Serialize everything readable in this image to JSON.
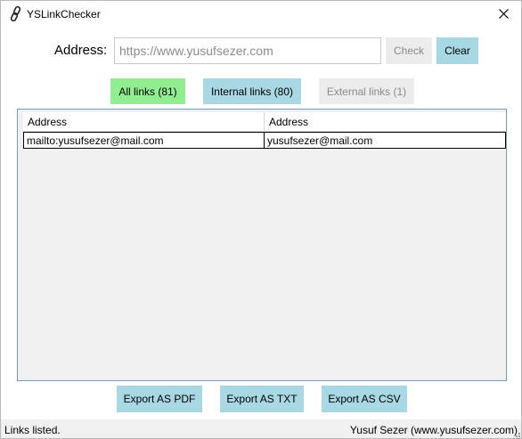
{
  "window": {
    "title": "YSLinkChecker",
    "app_icon": "link-icon",
    "close_icon": "close-icon"
  },
  "address": {
    "label": "Address:",
    "value": "",
    "placeholder": "https://www.yusufsezer.com",
    "check_label": "Check",
    "clear_label": "Clear"
  },
  "filters": {
    "all_label": "All links (81)",
    "internal_label": "Internal links (80)",
    "external_label": "External links (1)"
  },
  "grid": {
    "columns": [
      "Address",
      "Address"
    ],
    "rows": [
      [
        "mailto:yusufsezer@mail.com",
        "yusufsezer@mail.com"
      ]
    ]
  },
  "export": {
    "pdf_label": "Export AS PDF",
    "txt_label": "Export AS TXT",
    "csv_label": "Export AS CSV"
  },
  "status": {
    "left": "Links listed.",
    "right": "Yusuf Sezer (www.yusufsezer.com)"
  },
  "colors": {
    "all_button": "#90ee90",
    "accent_button": "#a8d8e3",
    "disabled_button": "#ececec",
    "grid_border": "#7a9ab8",
    "statusbar": "#f0f0f0"
  }
}
